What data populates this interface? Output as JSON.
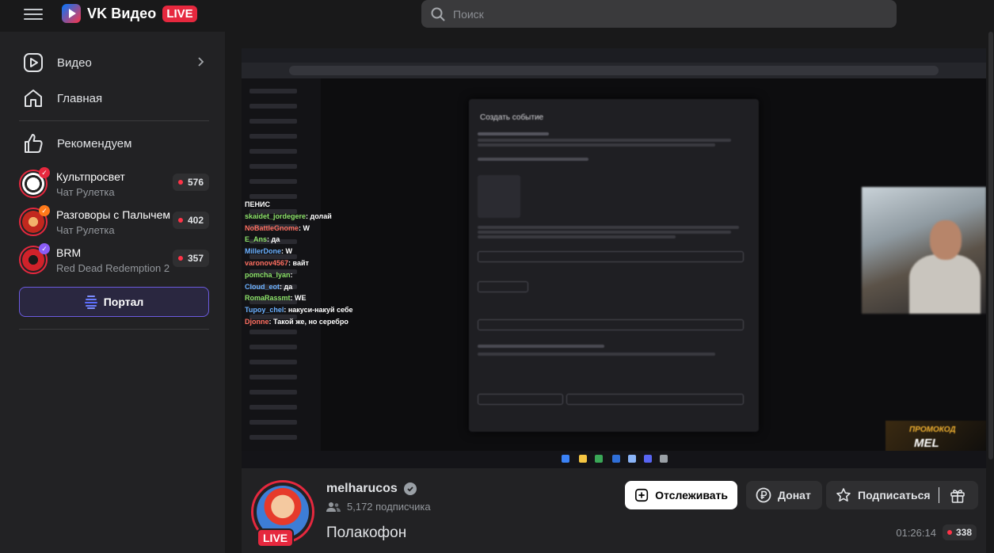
{
  "header": {
    "logo_text": "VK Видео",
    "live_label": "LIVE",
    "search_placeholder": "Поиск"
  },
  "sidebar": {
    "nav": [
      {
        "label": "Видео",
        "icon": "video-play-icon"
      },
      {
        "label": "Главная",
        "icon": "home-icon"
      },
      {
        "label": "Рекомендуем",
        "icon": "thumbs-up-icon"
      }
    ],
    "channels": [
      {
        "name": "Культпросвет",
        "game": "Чат Рулетка",
        "viewers": "576",
        "badge_color": "#e6283e"
      },
      {
        "name": "Разговоры с Палычем",
        "game": "Чат Рулетка",
        "viewers": "402",
        "badge_color": "#ff7a1a"
      },
      {
        "name": "BRM",
        "game": "Red Dead Redemption 2",
        "viewers": "357",
        "badge_color": "#8b5cf6"
      }
    ],
    "portal_label": "Портал"
  },
  "player": {
    "modal_title": "Создать событие",
    "chat": [
      {
        "user": "",
        "msg": "ПЕНИС"
      },
      {
        "user": "skaidet_jordegere",
        "msg": ": долай"
      },
      {
        "user": "NoBattleGnome",
        "msg": ": W"
      },
      {
        "user": "E_Ans",
        "msg": ": да"
      },
      {
        "user": "MillerDone",
        "msg": ": W"
      },
      {
        "user": "varonov4567",
        "msg": ": вайт"
      },
      {
        "user": "pomcha_lyan",
        "msg": ": "
      },
      {
        "user": "Cloud_eot",
        "msg": ": да"
      },
      {
        "user": "RomaRassmt",
        "msg": ": WE"
      },
      {
        "user": "Tupoy_chel",
        "msg": ": накуси-накуй себе"
      },
      {
        "user": "Djonne",
        "msg": ": Такой же, но серебро"
      }
    ],
    "promo_line1": "ПРОМОКОД",
    "promo_line2": "MEL"
  },
  "stream": {
    "streamer": "melharucos",
    "subscribers": "5,172 подписчика",
    "title": "Полакофон",
    "live_tag": "LIVE",
    "follow_label": "Отслеживать",
    "donate_label": "Донат",
    "subscribe_label": "Подписаться",
    "duration": "01:26:14",
    "viewers": "338"
  }
}
